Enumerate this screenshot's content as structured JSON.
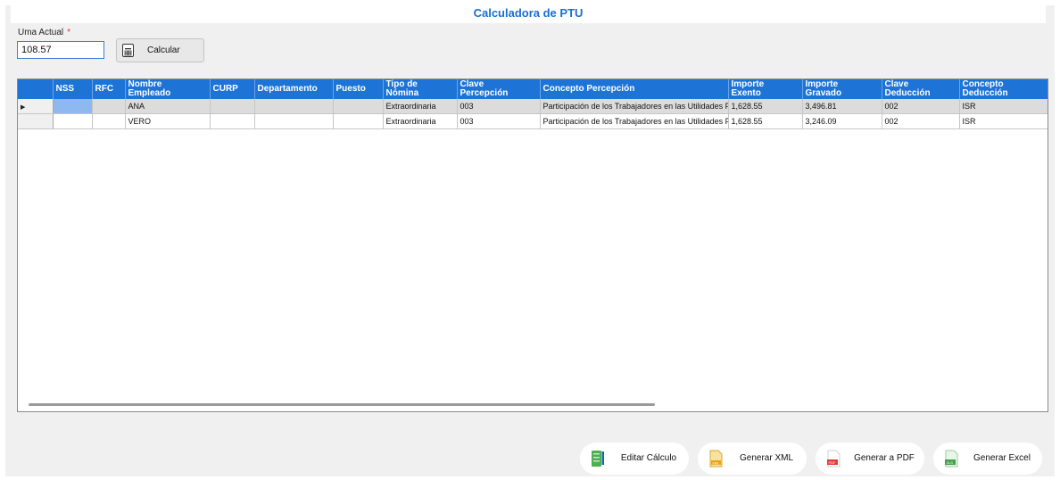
{
  "title": "Calculadora de PTU",
  "uma": {
    "label": "Uma Actual",
    "required_mark": "*",
    "value": "108.57"
  },
  "calc_button": {
    "label": "Calcular"
  },
  "grid": {
    "columns": [
      {
        "key": "nss",
        "label": "NSS"
      },
      {
        "key": "rfc",
        "label": "RFC"
      },
      {
        "key": "nombre",
        "label": "Nombre\nEmpleado"
      },
      {
        "key": "curp",
        "label": "CURP"
      },
      {
        "key": "depto",
        "label": "Departamento"
      },
      {
        "key": "puesto",
        "label": "Puesto"
      },
      {
        "key": "tipo",
        "label": "Tipo de\nNómina"
      },
      {
        "key": "clave_p",
        "label": "Clave\nPercepción"
      },
      {
        "key": "concepto_p",
        "label": "Concepto Percepción"
      },
      {
        "key": "exento",
        "label": "Importe\nExento"
      },
      {
        "key": "gravado",
        "label": "Importe\nGravado"
      },
      {
        "key": "clave_d",
        "label": "Clave\nDeducción"
      },
      {
        "key": "concepto_d",
        "label": "Concepto\nDeducción"
      }
    ],
    "rows": [
      {
        "selected": true,
        "indicator": "▶",
        "cells": [
          "",
          "",
          "ANA",
          "",
          "",
          "",
          "Extraordinaria",
          "003",
          "Participación de los Trabajadores en las Utilidades PTU",
          "1,628.55",
          "3,496.81",
          "002",
          "ISR"
        ]
      },
      {
        "selected": false,
        "indicator": "",
        "cells": [
          "",
          "",
          "VERO",
          "",
          "",
          "",
          "Extraordinaria",
          "003",
          "Participación de los Trabajadores en las Utilidades PTU",
          "1,628.55",
          "3,246.09",
          "002",
          "ISR"
        ]
      }
    ]
  },
  "actions": [
    {
      "id": "edit",
      "label": "Editar Cálculo",
      "icon": "spreadsheet-edit-icon"
    },
    {
      "id": "xml",
      "label": "Generar XML",
      "icon": "xml-file-icon"
    },
    {
      "id": "pdf",
      "label": "Generar a PDF",
      "icon": "pdf-file-icon"
    },
    {
      "id": "excel",
      "label": "Generar Excel",
      "icon": "excel-file-icon"
    }
  ],
  "colors": {
    "header_bg": "#1d74d6",
    "title": "#1a6fd0",
    "selected_row": "#dcdcdc",
    "current_cell": "#8fb7f0"
  }
}
